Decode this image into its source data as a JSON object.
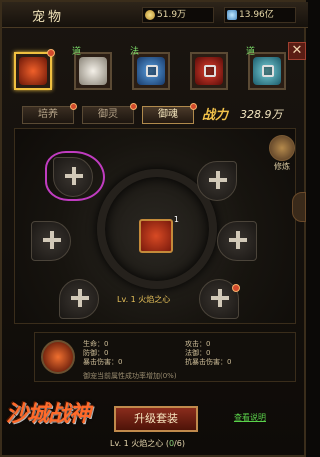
{
  "header": {
    "title": "宠物",
    "gold": "51.9万",
    "diamond": "13.96亿"
  },
  "pets": [
    {
      "tag": "",
      "active": true,
      "locked": false,
      "color": "#c83a1c"
    },
    {
      "tag": "道",
      "active": false,
      "locked": false,
      "color": "#d8d4cc"
    },
    {
      "tag": "法",
      "active": false,
      "locked": true,
      "color": "#2a6aa8"
    },
    {
      "tag": "",
      "active": false,
      "locked": true,
      "color": "#b8281c"
    },
    {
      "tag": "道",
      "active": false,
      "locked": true,
      "color": "#3aa0b0"
    }
  ],
  "tabs": [
    {
      "label": "培养",
      "active": false
    },
    {
      "label": "御灵",
      "active": false
    },
    {
      "label": "御魂",
      "active": true
    }
  ],
  "power": {
    "label": "战力",
    "value": "328.9万"
  },
  "stage": {
    "refine_label": "修炼",
    "center_level": "1",
    "soul_name": "Lv. 1  火焰之心"
  },
  "stats": {
    "hp": "生命：0",
    "attack": "攻击：0",
    "defense": "防御：0",
    "magic_def": "法御：0",
    "pierce": "暴击伤害：0",
    "crit_reduce": "抗暴击伤害：0",
    "note": "御宠当前属性成功率增加(0%)"
  },
  "bottom": {
    "logo": "沙城战神",
    "upgrade_label": "升级套装",
    "rules_link": "查看说明",
    "level_prefix": "Lv. 1  火焰之心  (",
    "progress": "0",
    "progress_total": "/6)"
  }
}
